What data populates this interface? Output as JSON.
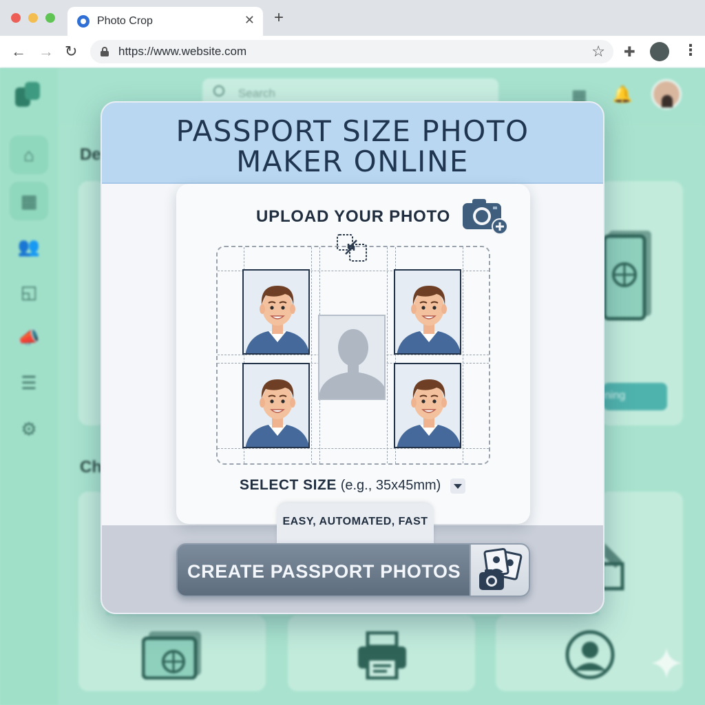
{
  "browser": {
    "tab_title": "Photo Crop",
    "tab_close": "✕",
    "new_tab": "+",
    "url": "https://www.website.com",
    "back": "←",
    "forward": "→",
    "reload": "↻",
    "bookmark": "☆",
    "extensions": "✚",
    "menu": "⋮"
  },
  "background": {
    "search_placeholder": "Search",
    "heading_1": "De",
    "heading_2": "Ch",
    "card_button": "ning",
    "nav_icons": [
      "home-icon",
      "grid-icon",
      "users-icon",
      "crop-icon",
      "megaphone-icon",
      "list-icon",
      "settings-icon"
    ],
    "nav_glyphs": [
      "⌂",
      "▦",
      "👥",
      "◱",
      "📣",
      "☰",
      "⚙"
    ],
    "top_grid_glyph": "▦",
    "bell_glyph": "🔔"
  },
  "modal": {
    "title_line_1": "PASSPORT SIZE PHOTO",
    "title_line_2": "MAKER ONLINE",
    "upload_label": "UPLOAD YOUR PHOTO",
    "size_label": "SELECT SIZE",
    "size_hint": "(e.g., 35x45mm)",
    "tagline": "EASY, AUTOMATED, FAST",
    "cta_label": "CREATE PASSPORT PHOTOS"
  },
  "colors": {
    "header": "#b9d7f1",
    "accent_dark": "#1f3550",
    "background_app": "#a9e3cf",
    "cta": "#6b7a8a"
  }
}
